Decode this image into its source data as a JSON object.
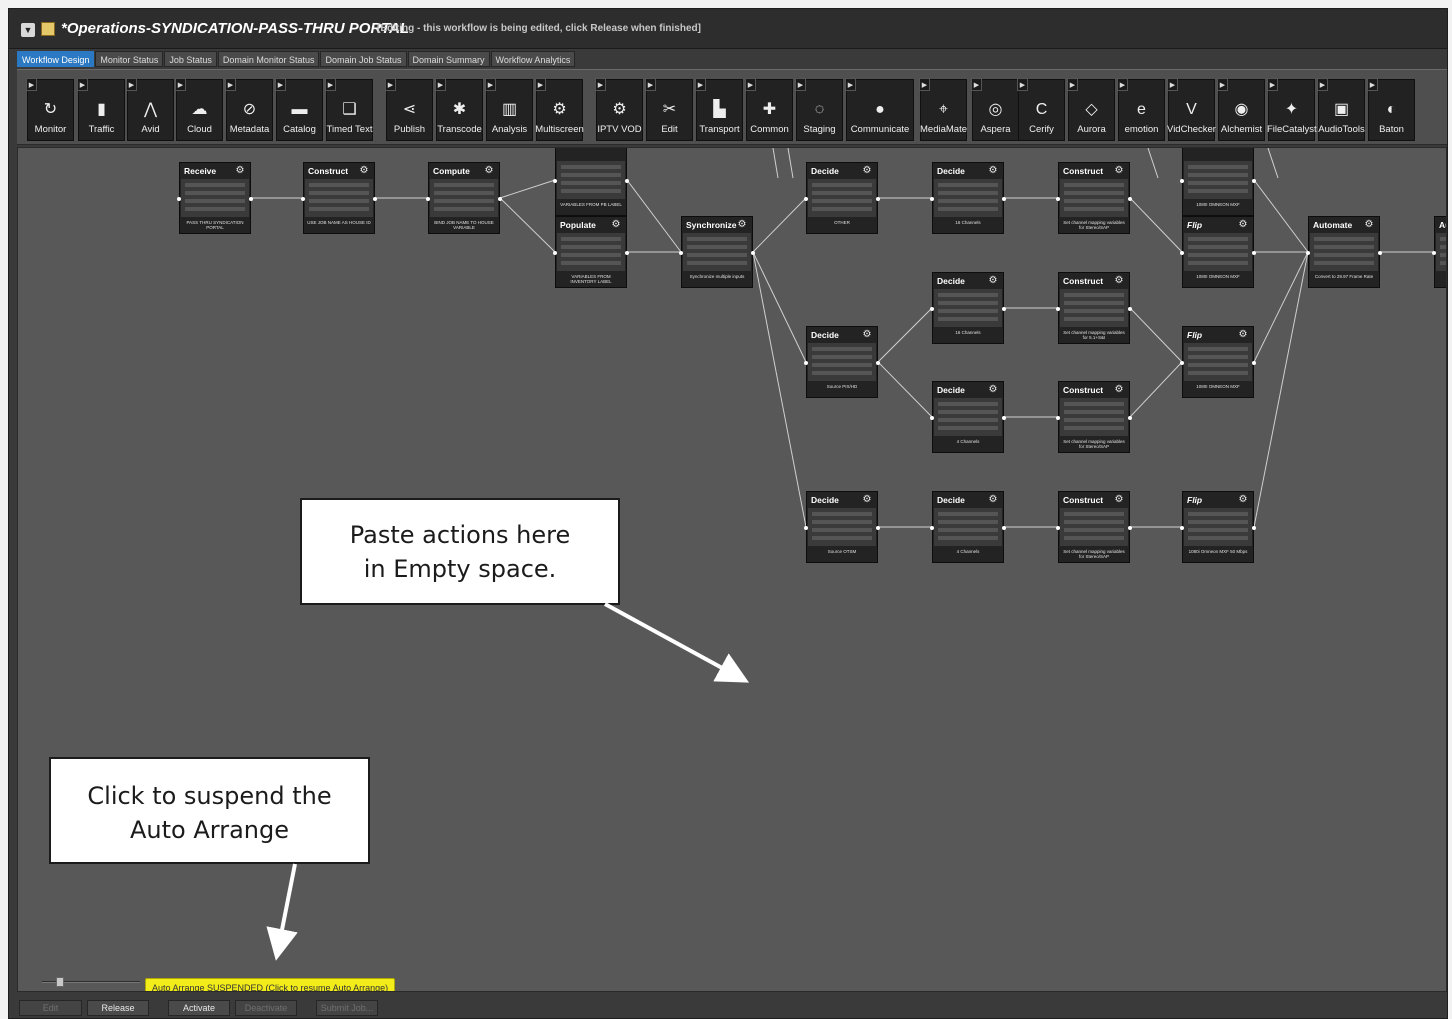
{
  "window": {
    "title": "*Operations-SYNDICATION-PASS-THRU PORTAL",
    "status": "[Editing - this workflow is being edited, click Release when finished]",
    "collapse_glyph": "▼",
    "title_icon": "edit-workflow-icon"
  },
  "tabs": [
    {
      "label": "Workflow Design",
      "active": true
    },
    {
      "label": "Monitor Status"
    },
    {
      "label": "Job Status"
    },
    {
      "label": "Domain Monitor Status"
    },
    {
      "label": "Domain Job Status"
    },
    {
      "label": "Domain Summary"
    },
    {
      "label": "Workflow Analytics"
    }
  ],
  "toolbar": {
    "expand_glyph": "▶",
    "items": [
      {
        "label": "Monitor",
        "icon": "↻"
      },
      {
        "label": "Traffic",
        "icon": "▮"
      },
      {
        "label": "Avid",
        "icon": "⋀"
      },
      {
        "label": "Cloud",
        "icon": "☁"
      },
      {
        "label": "Metadata",
        "icon": "⊘"
      },
      {
        "label": "Catalog",
        "icon": "▬"
      },
      {
        "label": "Timed Text",
        "icon": "❑"
      },
      {
        "label": "Publish",
        "icon": "⋖"
      },
      {
        "label": "Transcode",
        "icon": "✱"
      },
      {
        "label": "Analysis",
        "icon": "▥"
      },
      {
        "label": "Multiscreen",
        "icon": "⚙"
      },
      {
        "label": "IPTV VOD",
        "icon": "⚙"
      },
      {
        "label": "Edit",
        "icon": "✂"
      },
      {
        "label": "Transport",
        "icon": "▙"
      },
      {
        "label": "Common",
        "icon": "✚"
      },
      {
        "label": "Staging",
        "icon": "◌"
      },
      {
        "label": "Communicate",
        "icon": "●"
      },
      {
        "label": "MediaMate",
        "icon": "⌖"
      },
      {
        "label": "Aspera",
        "icon": "◎"
      },
      {
        "label": "Cerify",
        "icon": "C"
      },
      {
        "label": "Aurora",
        "icon": "◇"
      },
      {
        "label": "emotion",
        "icon": "e"
      },
      {
        "label": "VidChecker",
        "icon": "V"
      },
      {
        "label": "Alchemist",
        "icon": "◉"
      },
      {
        "label": "FileCatalyst",
        "icon": "✦"
      },
      {
        "label": "AudioTools",
        "icon": "▣"
      },
      {
        "label": "Baton",
        "icon": "◐"
      }
    ]
  },
  "workflow": {
    "nodes": {
      "receive": {
        "title": "Receive",
        "desc": "PASS THRU SYNDICATION PORTAL"
      },
      "construct1": {
        "title": "Construct",
        "desc": "USE JOB NAME AS HOUSE ID"
      },
      "compute": {
        "title": "Compute",
        "desc": "BIND JOB NAME TO HOUSE VARIABLE"
      },
      "top_node": {
        "title": "",
        "desc": "VARIABLES FROM PB LABEL"
      },
      "populate": {
        "title": "Populate",
        "desc": "VARIABLES FROM INVENTORY LABEL"
      },
      "synchronize": {
        "title": "Synchronize",
        "desc": "Synchronize multiple inputs"
      },
      "decide_other": {
        "title": "Decide",
        "desc": "OTHER"
      },
      "decide_16ch_a": {
        "title": "Decide",
        "desc": "16 Channels"
      },
      "construct_stereo_a": {
        "title": "Construct",
        "desc": "Set channel mapping variables for Stereo/SAP"
      },
      "flip_1080_top": {
        "title": "",
        "desc": "1080I OMNEON MXF"
      },
      "flip_a": {
        "title": "Flip",
        "desc": "1080I OMNEON MXF"
      },
      "automate": {
        "title": "Automate",
        "desc": "Convert to 29.97 Frame Rate"
      },
      "aut_partial": {
        "title": "Aut",
        "desc": ""
      },
      "decide_pixhd": {
        "title": "Decide",
        "desc": "Source PIX/HD"
      },
      "decide_16ch_b": {
        "title": "Decide",
        "desc": "16 Channels"
      },
      "construct_51": {
        "title": "Construct",
        "desc": "Set channel mapping variables for 5.1+S&I"
      },
      "flip_b": {
        "title": "Flip",
        "desc": "1080I OMNEON MXF"
      },
      "decide_4ch_a": {
        "title": "Decide",
        "desc": "4 Channels"
      },
      "construct_stereo_b": {
        "title": "Construct",
        "desc": "Set channel mapping variables for Stereo/SAP"
      },
      "decide_otsm": {
        "title": "Decide",
        "desc": "Source OTSM"
      },
      "decide_4ch_b": {
        "title": "Decide",
        "desc": "4 Channels"
      },
      "construct_stereo_c": {
        "title": "Construct",
        "desc": "Set channel mapping variables for Stereo/SAP"
      },
      "flip_c": {
        "title": "Flip",
        "desc": "1080i Omneon MXF 50 Mbps"
      }
    }
  },
  "callouts": {
    "paste_line1": "Paste actions here",
    "paste_line2": "in Empty space.",
    "suspend_line1": "Click to suspend the",
    "suspend_line2": "Auto Arrange"
  },
  "status": {
    "auto_arrange": "Auto Arrange SUSPENDED  (Click to resume Auto Arrange)"
  },
  "footer": {
    "edit": "Edit",
    "release": "Release",
    "activate": "Activate",
    "deactivate": "Deactivate",
    "submit_job": "Submit Job..."
  },
  "colors": {
    "active_tab": "#2b79c2",
    "auto_arrange_bg": "#f2ec1a",
    "canvas": "#585858"
  }
}
